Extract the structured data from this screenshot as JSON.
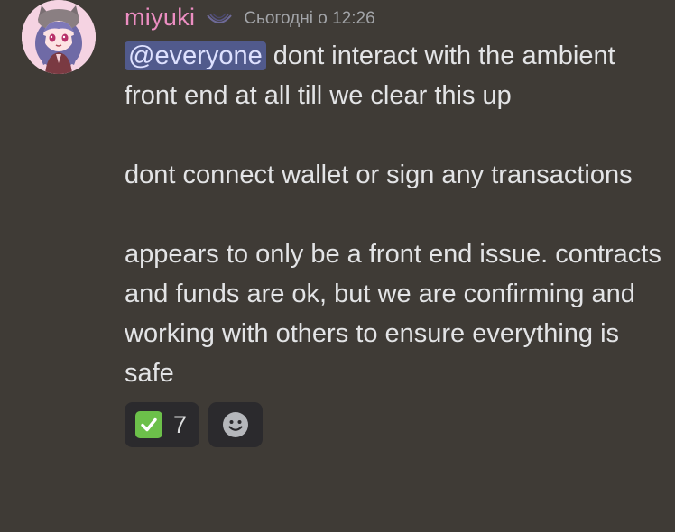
{
  "author": {
    "name": "miyuki",
    "avatar_icon": "anime-avatar-icon",
    "name_color": "#ec8ec2",
    "role_icon": "crescent-role-icon"
  },
  "timestamp": "Сьогодні о 12:26",
  "message": {
    "mention": "@everyone",
    "line1_rest": " dont interact with the ambient front end at all till we clear this up",
    "para2": "dont connect wallet or sign any transactions",
    "para3": "appears to only be a front end issue. contracts and funds are ok, but we are confirming and working with others to ensure everything is safe"
  },
  "reactions": [
    {
      "emoji_icon": "white-check-mark-icon",
      "count": "7"
    }
  ],
  "add_reaction_icon": "smiley-add-reaction-icon",
  "colors": {
    "background": "#3f3b36",
    "mention_bg": "#515a8c",
    "reaction_bg": "#2b2a2d",
    "check_green": "#6cc04a"
  }
}
